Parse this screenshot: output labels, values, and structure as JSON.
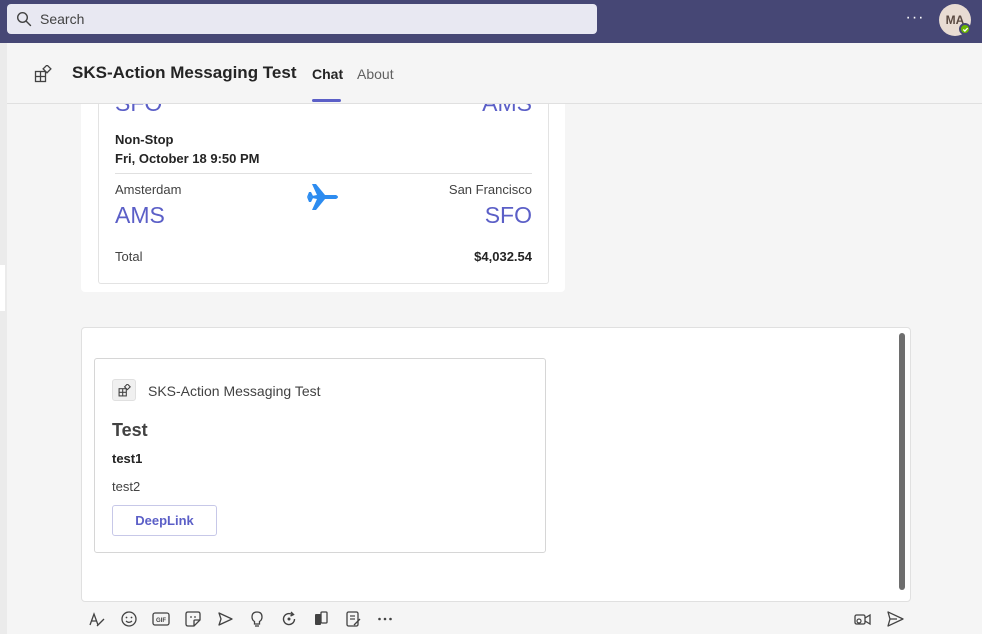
{
  "search": {
    "placeholder": "Search",
    "icon": "search-icon"
  },
  "topbar": {
    "more_label": "···",
    "avatar_initials": "MA",
    "presence_color": "#6bb700",
    "bar_color": "#464775"
  },
  "header": {
    "title": "SKS-Action Messaging Test",
    "tabs": [
      {
        "label": "Chat",
        "active": true
      },
      {
        "label": "About",
        "active": false
      }
    ],
    "accent": "#5b5fc7"
  },
  "flight_card": {
    "prev_origin_code": "SFO",
    "prev_destination_code": "AMS",
    "stops": "Non-Stop",
    "departure": "Fri, October 18 9:50 PM",
    "origin_city": "Amsterdam",
    "origin_code": "AMS",
    "destination_city": "San Francisco",
    "destination_code": "SFO",
    "total_label": "Total",
    "total_value": "$4,032.54",
    "plane_icon": "airplane-icon"
  },
  "compose_card": {
    "app_name": "SKS-Action Messaging Test",
    "title": "Test",
    "line1": "test1",
    "line2": "test2",
    "button_label": "DeepLink"
  },
  "toolbar": {
    "icons": [
      "format-icon",
      "emoji-icon",
      "gif-icon",
      "sticker-icon",
      "schedule-meeting-icon",
      "praise-icon",
      "loop-icon",
      "attach-icon",
      "approvals-icon",
      "more-icon",
      "dictate-icon",
      "send-icon"
    ]
  }
}
